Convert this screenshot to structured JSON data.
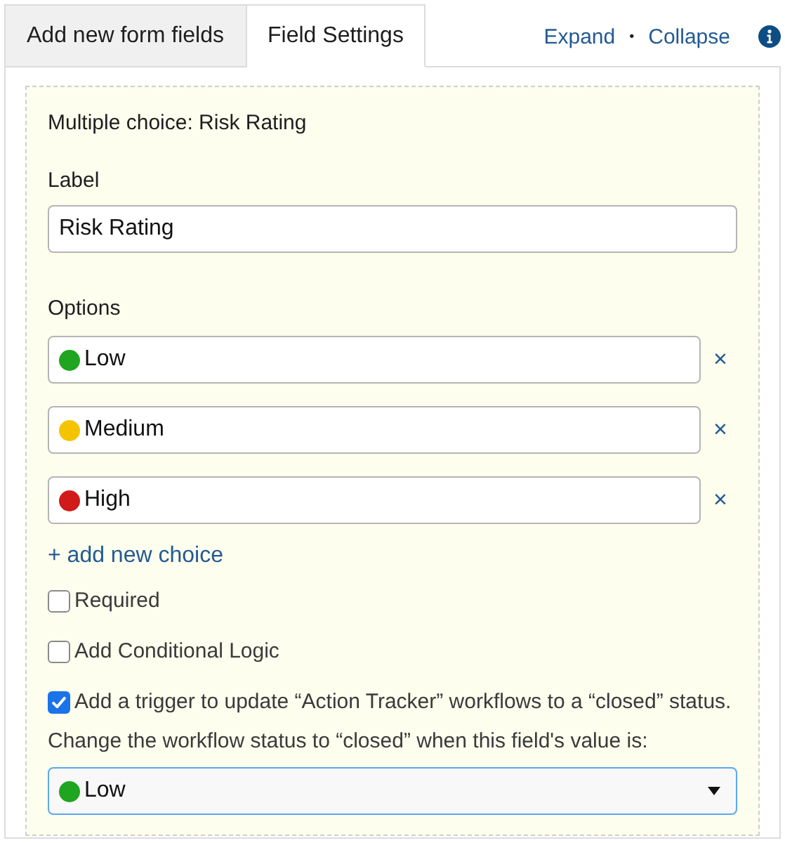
{
  "tabs": [
    {
      "label": "Add new form fields",
      "selected": false
    },
    {
      "label": "Field Settings",
      "selected": true
    }
  ],
  "header_links": [
    "Expand",
    "Collapse"
  ],
  "separator": "•",
  "field_title": "Multiple choice: Risk Rating",
  "label_field": {
    "label": "Label",
    "value": "Risk Rating"
  },
  "options": {
    "label": "Options",
    "items": [
      {
        "value": "Low",
        "color": "#1fa51f"
      },
      {
        "value": "Medium",
        "color": "#f5c400"
      },
      {
        "value": "High",
        "color": "#d11a1a"
      }
    ],
    "remove_symbol": "×",
    "add_link": "+ add new choice"
  },
  "checkboxes": [
    {
      "label": "Required",
      "checked": false
    },
    {
      "label": "Add Conditional Logic",
      "checked": false
    },
    {
      "label": "Add a trigger to update “Action Tracker” workflows to a “closed” status.",
      "checked": true
    }
  ],
  "trigger_select": {
    "label": "Change the workflow status to “closed” when this field's value is:",
    "value": "Low",
    "color": "#1fa51f"
  }
}
